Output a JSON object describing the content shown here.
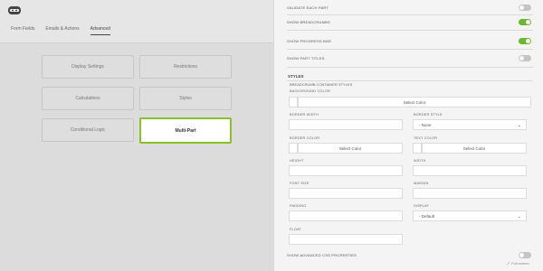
{
  "builder": {
    "tabs": [
      {
        "label": "Form Fields"
      },
      {
        "label": "Emails & Actions"
      },
      {
        "label": "Advanced"
      }
    ],
    "tiles": [
      {
        "label": "Display Settings"
      },
      {
        "label": "Restrictions"
      },
      {
        "label": "Calculations"
      },
      {
        "label": "Styles"
      },
      {
        "label": "Conditional Logic"
      },
      {
        "label": "Multi-Part"
      }
    ]
  },
  "settings": {
    "toggles": [
      {
        "label": "VALIDATE EACH PART",
        "on": false
      },
      {
        "label": "SHOW BREADCRUMBS",
        "on": true
      },
      {
        "label": "SHOW PROGRESS BAR",
        "on": true
      },
      {
        "label": "SHOW PART TITLES",
        "on": false
      }
    ],
    "styles_title": "STYLES",
    "fieldset_label": "BREADCRUMB CONTAINER STYLES",
    "background_color": {
      "label": "BACKGROUND COLOR",
      "button": "Select Color"
    },
    "border_width": {
      "label": "BORDER WIDTH",
      "value": ""
    },
    "border_style": {
      "label": "BORDER STYLE",
      "value": "- None"
    },
    "border_color": {
      "label": "BORDER COLOR",
      "button": "Select Color"
    },
    "text_color": {
      "label": "TEXT COLOR",
      "button": "Select Color"
    },
    "height": {
      "label": "HEIGHT",
      "value": ""
    },
    "width": {
      "label": "WIDTH",
      "value": ""
    },
    "font_size": {
      "label": "FONT SIZE",
      "value": ""
    },
    "margin": {
      "label": "MARGIN",
      "value": ""
    },
    "padding": {
      "label": "PADDING",
      "value": ""
    },
    "display": {
      "label": "DISPLAY",
      "value": "- Default"
    },
    "float": {
      "label": "FLOAT",
      "value": ""
    },
    "advanced_css": {
      "label": "SHOW ADVANCED CSS PROPERTIES",
      "on": false
    },
    "full_screen": "Full screen"
  },
  "colors": {
    "accent_green": "#6ab82d",
    "active_tile_border": "#8bbf2b"
  }
}
